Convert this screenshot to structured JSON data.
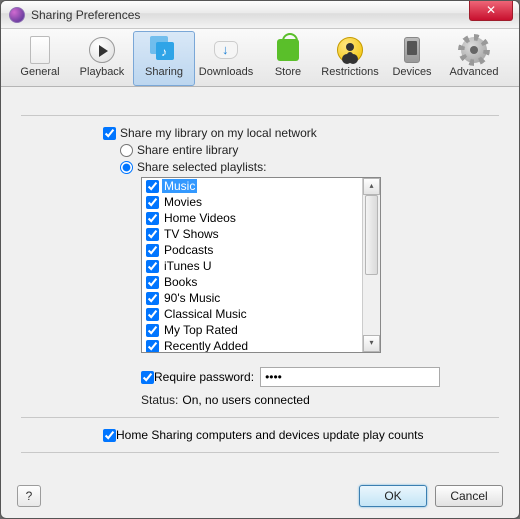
{
  "window": {
    "title": "Sharing Preferences"
  },
  "toolbar": {
    "tabs": [
      {
        "label": "General"
      },
      {
        "label": "Playback"
      },
      {
        "label": "Sharing",
        "active": true
      },
      {
        "label": "Downloads"
      },
      {
        "label": "Store"
      },
      {
        "label": "Restrictions"
      },
      {
        "label": "Devices"
      },
      {
        "label": "Advanced"
      }
    ]
  },
  "sharing": {
    "share_library_label": "Share my library on my local network",
    "share_library_checked": true,
    "entire_label": "Share entire library",
    "selected_label": "Share selected playlists:",
    "radio_selected": "selected",
    "playlists": [
      {
        "name": "Music",
        "checked": true,
        "selected": true
      },
      {
        "name": "Movies",
        "checked": true
      },
      {
        "name": "Home Videos",
        "checked": true
      },
      {
        "name": "TV Shows",
        "checked": true
      },
      {
        "name": "Podcasts",
        "checked": true
      },
      {
        "name": "iTunes U",
        "checked": true
      },
      {
        "name": "Books",
        "checked": true
      },
      {
        "name": "90's Music",
        "checked": true
      },
      {
        "name": "Classical Music",
        "checked": true
      },
      {
        "name": "My Top Rated",
        "checked": true
      },
      {
        "name": "Recently Added",
        "checked": true
      }
    ],
    "require_pw_label": "Require password:",
    "require_pw_checked": true,
    "password_value": "••••",
    "status_label": "Status:",
    "status_value": "On, no users connected",
    "home_sharing_label": "Home Sharing computers and devices update play counts",
    "home_sharing_checked": true
  },
  "footer": {
    "help": "?",
    "ok": "OK",
    "cancel": "Cancel"
  }
}
